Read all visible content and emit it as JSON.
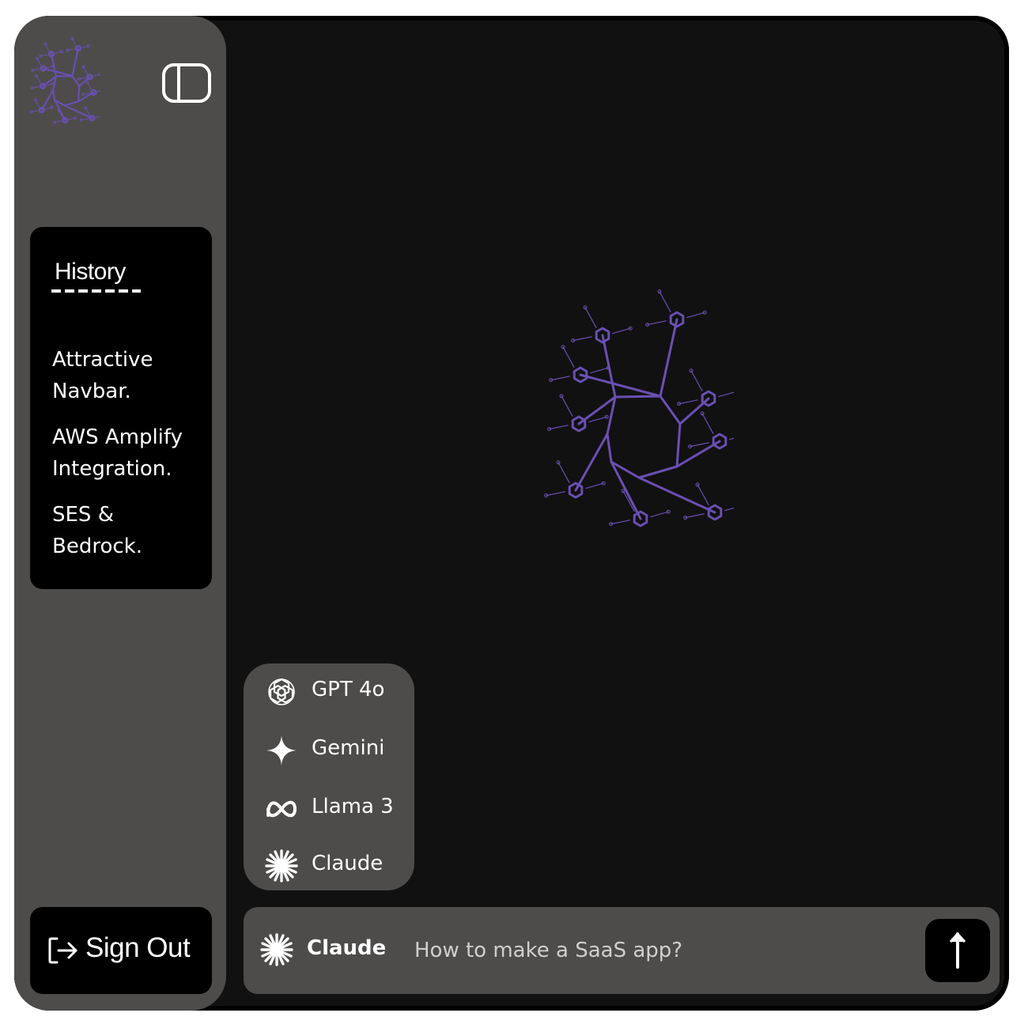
{
  "sidebar": {
    "history_title": "History",
    "history_items": [
      "Attractive Navbar.",
      "AWS Amplify Integration.",
      "SES & Bedrock."
    ],
    "signout_label": "Sign Out"
  },
  "models": [
    {
      "label": "GPT 4o",
      "icon": "openai-icon"
    },
    {
      "label": "Gemini",
      "icon": "gemini-sparkle-icon"
    },
    {
      "label": "Llama 3",
      "icon": "meta-infinity-icon"
    },
    {
      "label": "Claude",
      "icon": "claude-burst-icon"
    }
  ],
  "input": {
    "selected_model": "Claude",
    "placeholder": "How to make a SaaS app?"
  },
  "colors": {
    "sidebar_bg": "#4d4c4b",
    "main_bg": "#111111",
    "panel_bg": "#000000",
    "accent_purple": "#6a4fb3",
    "text": "#ffffff"
  }
}
